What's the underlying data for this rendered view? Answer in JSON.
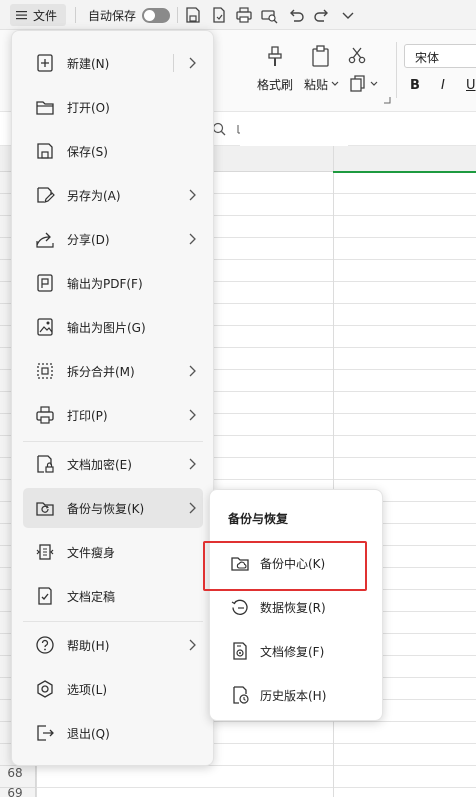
{
  "topbar": {
    "file_label": "文件",
    "autosave_label": "自动保存",
    "autosave_on": false
  },
  "ribbon": {
    "format_painter": "格式刷",
    "paste": "粘贴",
    "font_name": "宋体",
    "bold": "B",
    "italic": "I",
    "underline": "U"
  },
  "sheet": {
    "row_numbers": [
      "68",
      "69"
    ]
  },
  "file_menu": {
    "items": [
      {
        "label": "新建(N)",
        "icon": "new-file-icon",
        "submenu": true
      },
      {
        "label": "打开(O)",
        "icon": "folder-open-icon",
        "submenu": false
      },
      {
        "label": "保存(S)",
        "icon": "save-icon",
        "submenu": false
      },
      {
        "label": "另存为(A)",
        "icon": "save-as-icon",
        "submenu": true
      },
      {
        "label": "分享(D)",
        "icon": "share-icon",
        "submenu": true
      },
      {
        "label": "输出为PDF(F)",
        "icon": "pdf-export-icon",
        "submenu": false
      },
      {
        "label": "输出为图片(G)",
        "icon": "image-export-icon",
        "submenu": false
      },
      {
        "label": "拆分合并(M)",
        "icon": "split-merge-icon",
        "submenu": true
      },
      {
        "label": "打印(P)",
        "icon": "print-icon",
        "submenu": true
      },
      {
        "label": "文档加密(E)",
        "icon": "encrypt-icon",
        "submenu": true
      },
      {
        "label": "备份与恢复(K)",
        "icon": "backup-restore-icon",
        "submenu": true
      },
      {
        "label": "文件瘦身",
        "icon": "file-slim-icon",
        "submenu": false
      },
      {
        "label": "文档定稿",
        "icon": "finalize-icon",
        "submenu": false
      },
      {
        "label": "帮助(H)",
        "icon": "help-icon",
        "submenu": true
      },
      {
        "label": "选项(L)",
        "icon": "options-icon",
        "submenu": false
      },
      {
        "label": "退出(Q)",
        "icon": "exit-icon",
        "submenu": false
      }
    ]
  },
  "backup_submenu": {
    "title": "备份与恢复",
    "items": [
      {
        "label": "备份中心(K)",
        "icon": "backup-center-icon"
      },
      {
        "label": "数据恢复(R)",
        "icon": "data-recovery-icon"
      },
      {
        "label": "文档修复(F)",
        "icon": "document-repair-icon"
      },
      {
        "label": "历史版本(H)",
        "icon": "history-version-icon"
      }
    ]
  },
  "colors": {
    "highlight": "#e03131",
    "selected_column": "#1d9a3f"
  }
}
